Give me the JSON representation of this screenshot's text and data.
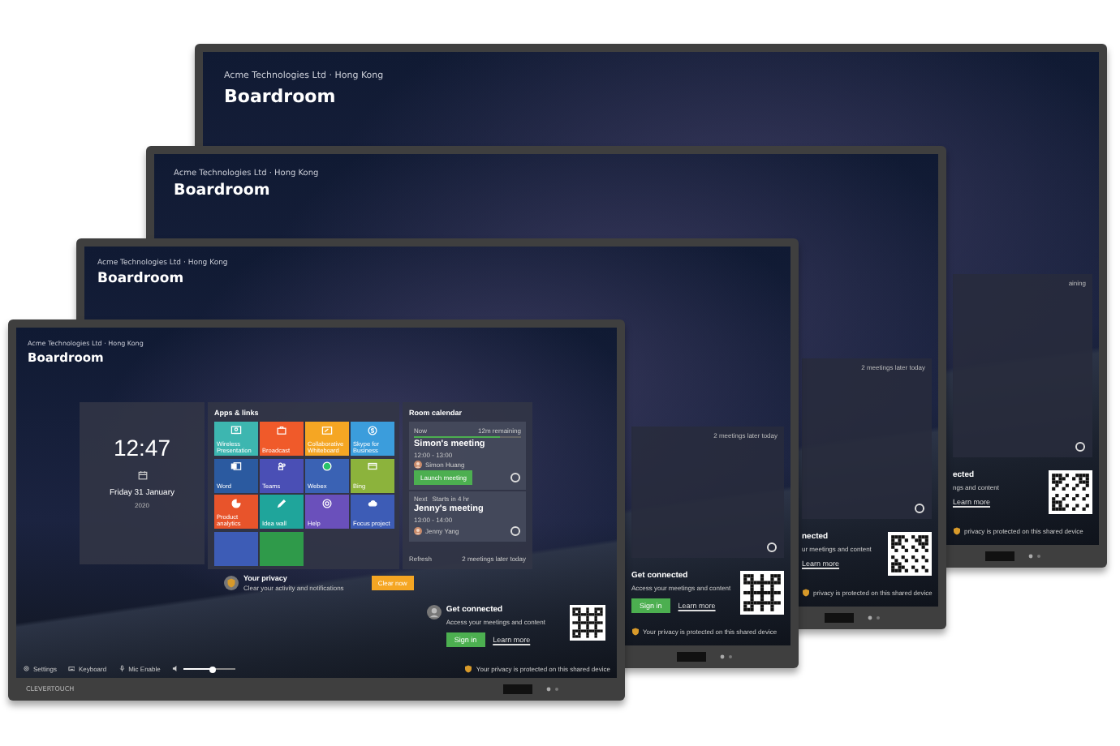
{
  "back_displays": [
    {
      "company": "Acme Technologies Ltd · Hong Kong",
      "room": "Boardroom",
      "strip": {
        "note": "aining",
        "title": "ected",
        "subtitle": "ngs and content",
        "learn_more": "Learn more",
        "privacy": "privacy is protected on this shared device"
      }
    },
    {
      "company": "Acme Technologies Ltd · Hong Kong",
      "room": "Boardroom",
      "strip": {
        "note": "2 meetings later today",
        "title": "nected",
        "subtitle": "ur meetings and content",
        "learn_more": "Learn more",
        "privacy": "privacy is protected on this shared device"
      }
    },
    {
      "company": "Acme Technologies Ltd · Hong Kong",
      "room": "Boardroom",
      "strip": {
        "note": "2 meetings later today",
        "title": "Get connected",
        "subtitle": "Access your meetings and content",
        "sign_in": "Sign in",
        "learn_more": "Learn more",
        "privacy": "Your privacy is protected on this shared device"
      }
    }
  ],
  "front_display": {
    "company": "Acme Technologies Ltd · Hong Kong",
    "room": "Boardroom",
    "brand": "CLEVERTOUCH",
    "clock": {
      "time": "12:47",
      "date": "Friday 31 January",
      "year": "2020"
    },
    "apps": {
      "title": "Apps & links",
      "tiles": [
        {
          "kind": "presentation",
          "label": "Wireless Presentation",
          "color": "#3db6b0"
        },
        {
          "kind": "broadcast",
          "label": "Broadcast",
          "color": "#f05a2a"
        },
        {
          "kind": "whiteboard",
          "label": "Collaborative Whiteboard",
          "color": "#f5a623"
        },
        {
          "kind": "skype",
          "label": "Skype for Business",
          "color": "#3b9ddc"
        },
        {
          "kind": "word",
          "label": "Word",
          "color": "#2b5aa0"
        },
        {
          "kind": "teams",
          "label": "Teams",
          "color": "#4a4fb5"
        },
        {
          "kind": "webex",
          "label": "Webex",
          "color": "#3a62b4"
        },
        {
          "kind": "bing",
          "label": "Bing",
          "color": "#8cb33c"
        },
        {
          "kind": "analytics",
          "label": "Product analytics",
          "color": "#e8542b"
        },
        {
          "kind": "pen",
          "label": "Idea wall",
          "color": "#1fa59b"
        },
        {
          "kind": "help",
          "label": "Help",
          "color": "#6a50bb"
        },
        {
          "kind": "cloud",
          "label": "Focus project",
          "color": "#3d5cb6"
        },
        {
          "kind": "partial",
          "color": "#3d5cb6"
        },
        {
          "kind": "partial",
          "color": "#2f9a4a"
        }
      ]
    },
    "calendar": {
      "title": "Room calendar",
      "now": {
        "label": "Now",
        "remaining": "12m remaining",
        "level": 0.8,
        "meeting": "Simon's meeting",
        "time": "12:00 - 13:00",
        "person": "Simon Huang",
        "button": "Launch meeting"
      },
      "next": {
        "label": "Next",
        "starts": "Starts in 4 hr",
        "meeting": "Jenny's meeting",
        "time": "13:00 - 14:00",
        "person": "Jenny Yang"
      },
      "refresh": "Refresh",
      "later": "2 meetings later today"
    },
    "privacy": {
      "title": "Your privacy",
      "subtitle": "Clear your activity and notifications",
      "button": "Clear now"
    },
    "connect": {
      "title": "Get connected",
      "subtitle": "Access your meetings and content",
      "sign_in": "Sign in",
      "learn_more": "Learn more"
    },
    "privacy_note": "Your privacy is protected on this shared device",
    "toolbar": [
      {
        "kind": "settings",
        "label": "Settings"
      },
      {
        "kind": "keyboard",
        "label": "Keyboard"
      },
      {
        "kind": "mic",
        "label": "Mic Enable"
      }
    ],
    "volume": {
      "level": 0.55
    }
  }
}
